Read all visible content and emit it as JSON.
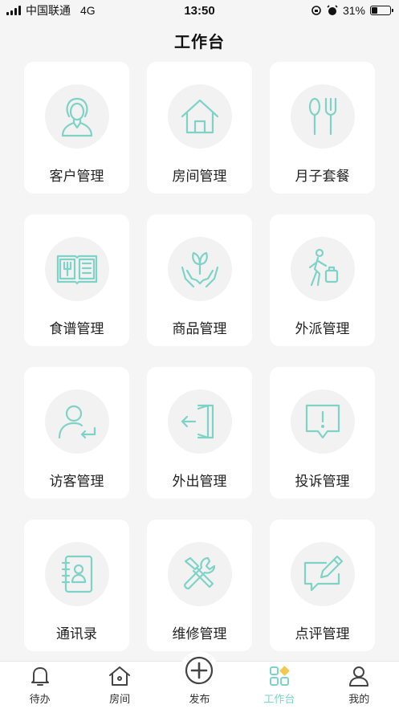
{
  "status_bar": {
    "carrier": "中国联通",
    "network": "4G",
    "time": "13:50",
    "battery_percent": "31%",
    "battery_level": 0.31
  },
  "page": {
    "title": "工作台"
  },
  "accent_color": "#7fd3c6",
  "tiles": [
    {
      "label": "客户管理",
      "icon": "woman-avatar-icon"
    },
    {
      "label": "房间管理",
      "icon": "house-icon"
    },
    {
      "label": "月子套餐",
      "icon": "spoon-fork-icon"
    },
    {
      "label": "食谱管理",
      "icon": "recipe-book-icon"
    },
    {
      "label": "商品管理",
      "icon": "hands-plant-icon"
    },
    {
      "label": "外派管理",
      "icon": "traveler-luggage-icon"
    },
    {
      "label": "访客管理",
      "icon": "visitor-return-icon"
    },
    {
      "label": "外出管理",
      "icon": "exit-door-icon"
    },
    {
      "label": "投诉管理",
      "icon": "complaint-alert-icon"
    },
    {
      "label": "通讯录",
      "icon": "address-book-icon"
    },
    {
      "label": "维修管理",
      "icon": "wrench-screwdriver-icon"
    },
    {
      "label": "点评管理",
      "icon": "comment-pen-icon"
    }
  ],
  "tabbar": {
    "items": [
      {
        "label": "待办",
        "icon": "bell-icon"
      },
      {
        "label": "房间",
        "icon": "room-house-icon"
      },
      {
        "label": "发布",
        "icon": "plus-circle-icon"
      },
      {
        "label": "工作台",
        "icon": "workbench-grid-icon",
        "active": true
      },
      {
        "label": "我的",
        "icon": "user-icon"
      }
    ]
  }
}
